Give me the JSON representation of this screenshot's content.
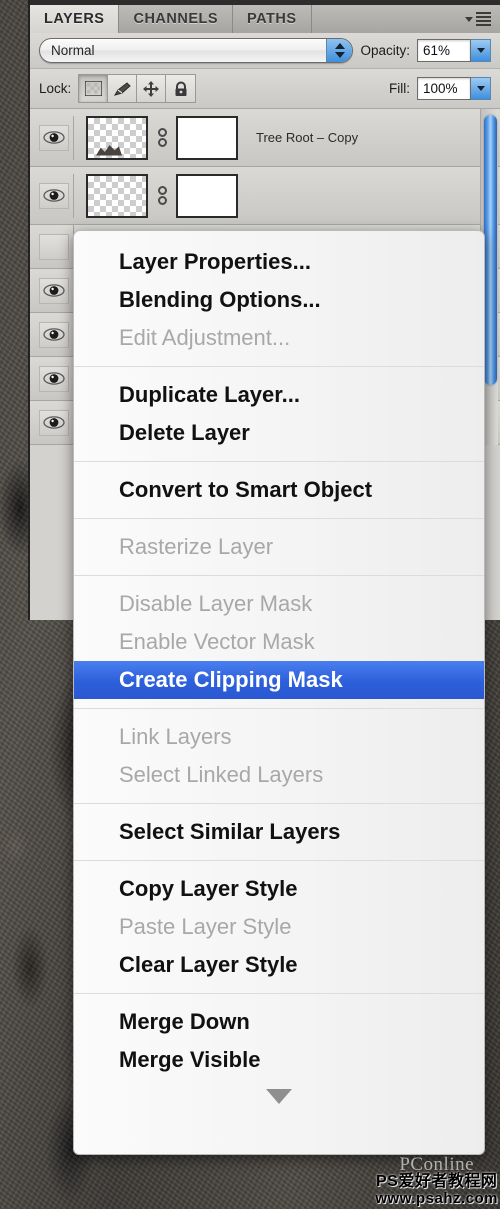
{
  "panel": {
    "tabs": [
      {
        "label": "LAYERS",
        "active": true
      },
      {
        "label": "CHANNELS",
        "active": false
      },
      {
        "label": "PATHS",
        "active": false
      }
    ],
    "menu_icon": "panel-menu-icon",
    "blend": {
      "mode": "Normal",
      "opacity_label": "Opacity:",
      "opacity_value": "61%"
    },
    "lock": {
      "label": "Lock:",
      "buttons": [
        {
          "name": "lock-transparent-pixels",
          "icon": "checkerboard-icon"
        },
        {
          "name": "lock-image-pixels",
          "icon": "brush-icon"
        },
        {
          "name": "lock-position",
          "icon": "move-icon"
        },
        {
          "name": "lock-all",
          "icon": "lock-icon"
        }
      ],
      "fill_label": "Fill:",
      "fill_value": "100%"
    },
    "layers": [
      {
        "name": "Tree Root – Copy",
        "visible": true,
        "has_mask": true
      },
      {
        "name": "",
        "visible": true,
        "has_mask": true
      },
      {
        "name": "",
        "visible": false,
        "has_mask": false
      },
      {
        "name": "",
        "visible": true,
        "has_mask": false
      },
      {
        "name": "",
        "visible": true,
        "has_mask": false
      },
      {
        "name": "",
        "visible": true,
        "has_mask": false
      },
      {
        "name": "",
        "visible": true,
        "has_mask": false
      }
    ]
  },
  "context_menu": {
    "groups": [
      [
        {
          "label": "Layer Properties...",
          "state": "normal"
        },
        {
          "label": "Blending Options...",
          "state": "normal"
        },
        {
          "label": "Edit Adjustment...",
          "state": "disabled"
        }
      ],
      [
        {
          "label": "Duplicate Layer...",
          "state": "normal"
        },
        {
          "label": "Delete Layer",
          "state": "normal"
        }
      ],
      [
        {
          "label": "Convert to Smart Object",
          "state": "normal"
        }
      ],
      [
        {
          "label": "Rasterize Layer",
          "state": "disabled"
        }
      ],
      [
        {
          "label": "Disable Layer Mask",
          "state": "disabled"
        },
        {
          "label": "Enable Vector Mask",
          "state": "disabled"
        },
        {
          "label": "Create Clipping Mask",
          "state": "selected"
        }
      ],
      [
        {
          "label": "Link Layers",
          "state": "disabled"
        },
        {
          "label": "Select Linked Layers",
          "state": "disabled"
        }
      ],
      [
        {
          "label": "Select Similar Layers",
          "state": "normal"
        }
      ],
      [
        {
          "label": "Copy Layer Style",
          "state": "normal"
        },
        {
          "label": "Paste Layer Style",
          "state": "disabled"
        },
        {
          "label": "Clear Layer Style",
          "state": "normal"
        }
      ],
      [
        {
          "label": "Merge Down",
          "state": "normal"
        },
        {
          "label": "Merge Visible",
          "state": "normal"
        }
      ]
    ],
    "scroll_arrow_icon": "chevron-down-icon",
    "highlight_color": "#2d5fdb"
  },
  "watermark": {
    "brand": "PConline",
    "site_cn": "PS爱好者教程网",
    "site_url": "www.psahz.com"
  }
}
